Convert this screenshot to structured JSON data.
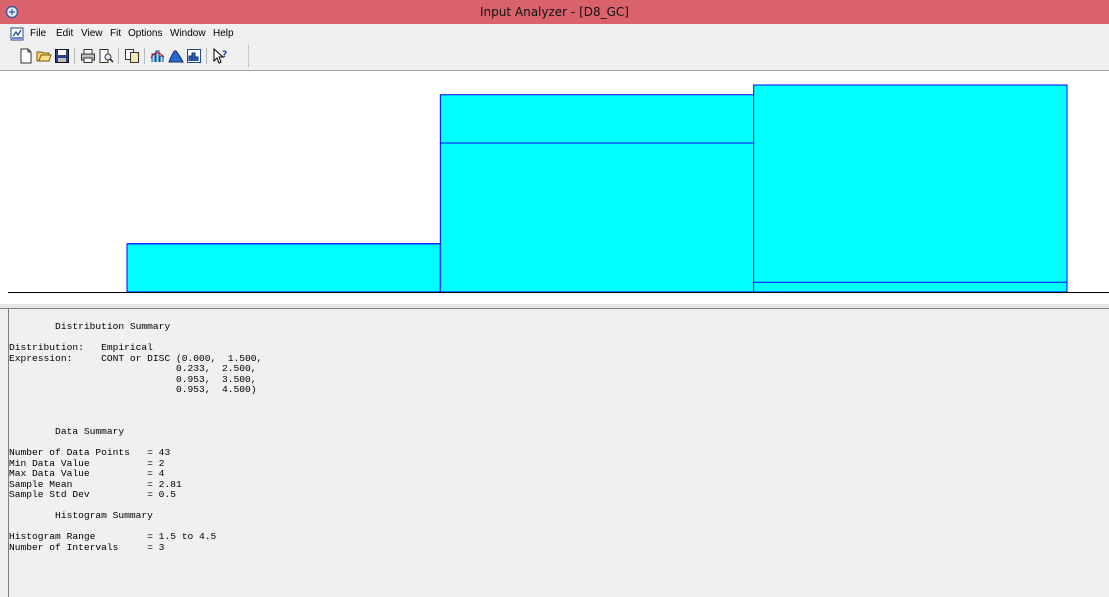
{
  "window": {
    "title": "Input Analyzer - [D8_GC]"
  },
  "menu": {
    "items": [
      "File",
      "Edit",
      "View",
      "Fit",
      "Options",
      "Window",
      "Help"
    ]
  },
  "toolbar": {
    "buttons": [
      "new-icon",
      "open-icon",
      "save-icon",
      "print-icon",
      "print-preview-icon",
      "copy-icon",
      "fit-icon",
      "distribution-icon",
      "histogram-icon",
      "context-help-icon"
    ]
  },
  "colors": {
    "titlebar": "#d9626b",
    "bar_fill": "#00ffff",
    "bar_stroke": "#0000ff"
  },
  "chart_data": {
    "type": "bar",
    "bins": [
      [
        1.5,
        2.5
      ],
      [
        2.5,
        3.5
      ],
      [
        3.5,
        4.5
      ]
    ],
    "values": [
      0.233,
      0.72,
      0.047
    ],
    "fitted_curve": [
      0.233,
      0.953,
      1.0
    ],
    "xlim": [
      1.5,
      4.5
    ],
    "grid": false
  },
  "report": {
    "lines": [
      "        Distribution Summary",
      "",
      "Distribution:   Empirical",
      "Expression:     CONT or DISC (0.000,  1.500,",
      "                             0.233,  2.500,",
      "                             0.953,  3.500,",
      "                             0.953,  4.500)",
      "",
      "",
      "",
      "        Data Summary",
      "",
      "Number of Data Points   = 43",
      "Min Data Value          = 2",
      "Max Data Value          = 4",
      "Sample Mean             = 2.81",
      "Sample Std Dev          = 0.5",
      "",
      "        Histogram Summary",
      "",
      "Histogram Range         = 1.5 to 4.5",
      "Number of Intervals     = 3"
    ]
  }
}
